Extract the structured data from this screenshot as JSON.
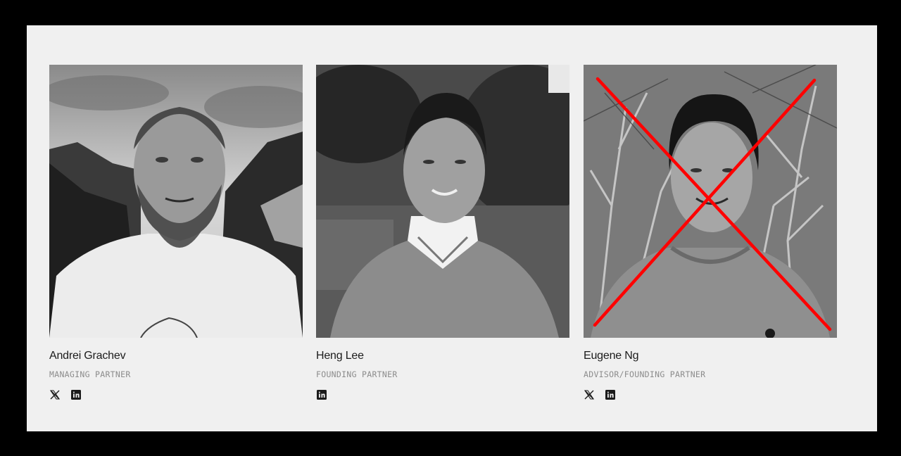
{
  "team": [
    {
      "name": "Andrei Grachev",
      "role": "MANAGING PARTNER",
      "socials": [
        "x-icon",
        "linkedin-icon"
      ],
      "crossed_out": false
    },
    {
      "name": "Heng Lee",
      "role": "FOUNDING PARTNER",
      "socials": [
        "linkedin-icon"
      ],
      "crossed_out": false
    },
    {
      "name": "Eugene Ng",
      "role": "ADVISOR/FOUNDING PARTNER",
      "socials": [
        "x-icon",
        "linkedin-icon"
      ],
      "crossed_out": true
    }
  ],
  "colors": {
    "page_background": "#000000",
    "panel_background": "#f0f0f0",
    "name_text": "#1b1b1b",
    "role_text": "#8c8c8c",
    "cross_mark": "#ff0000"
  }
}
